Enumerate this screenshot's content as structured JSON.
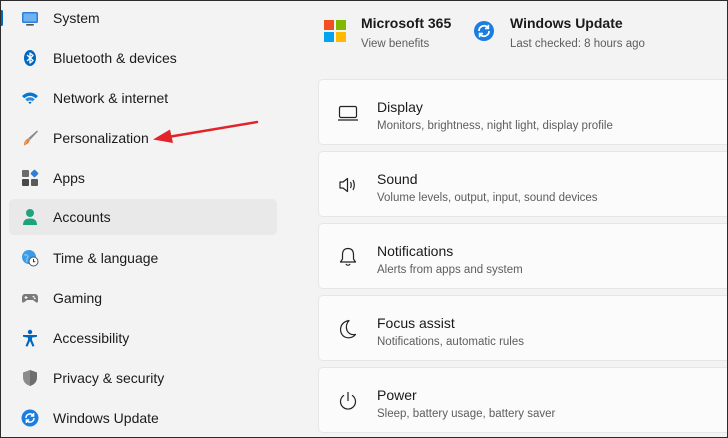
{
  "sidebar": {
    "items": [
      {
        "label": "System",
        "icon": "monitor-icon"
      },
      {
        "label": "Bluetooth & devices",
        "icon": "bluetooth-icon"
      },
      {
        "label": "Network & internet",
        "icon": "wifi-icon"
      },
      {
        "label": "Personalization",
        "icon": "paintbrush-icon"
      },
      {
        "label": "Apps",
        "icon": "apps-icon"
      },
      {
        "label": "Accounts",
        "icon": "person-icon"
      },
      {
        "label": "Time & language",
        "icon": "globe-clock-icon"
      },
      {
        "label": "Gaming",
        "icon": "gamepad-icon"
      },
      {
        "label": "Accessibility",
        "icon": "accessibility-icon"
      },
      {
        "label": "Privacy & security",
        "icon": "shield-icon"
      },
      {
        "label": "Windows Update",
        "icon": "sync-icon"
      }
    ],
    "selected": "Accounts"
  },
  "top": {
    "microsoft365": {
      "title": "Microsoft 365",
      "subtitle": "View benefits"
    },
    "windows_update": {
      "title": "Windows Update",
      "subtitle": "Last checked: 8 hours ago"
    }
  },
  "cards": [
    {
      "title": "Display",
      "subtitle": "Monitors, brightness, night light, display profile",
      "icon": "display-icon"
    },
    {
      "title": "Sound",
      "subtitle": "Volume levels, output, input, sound devices",
      "icon": "speaker-icon"
    },
    {
      "title": "Notifications",
      "subtitle": "Alerts from apps and system",
      "icon": "bell-icon"
    },
    {
      "title": "Focus assist",
      "subtitle": "Notifications, automatic rules",
      "icon": "moon-icon"
    },
    {
      "title": "Power",
      "subtitle": "Sleep, battery usage, battery saver",
      "icon": "power-icon"
    }
  ],
  "annotation": {
    "color": "#e0242a",
    "points_to": "Personalization"
  },
  "colors": {
    "accent": "#0067c0",
    "background": "#f3f3f3",
    "card": "#fbfbfb"
  }
}
